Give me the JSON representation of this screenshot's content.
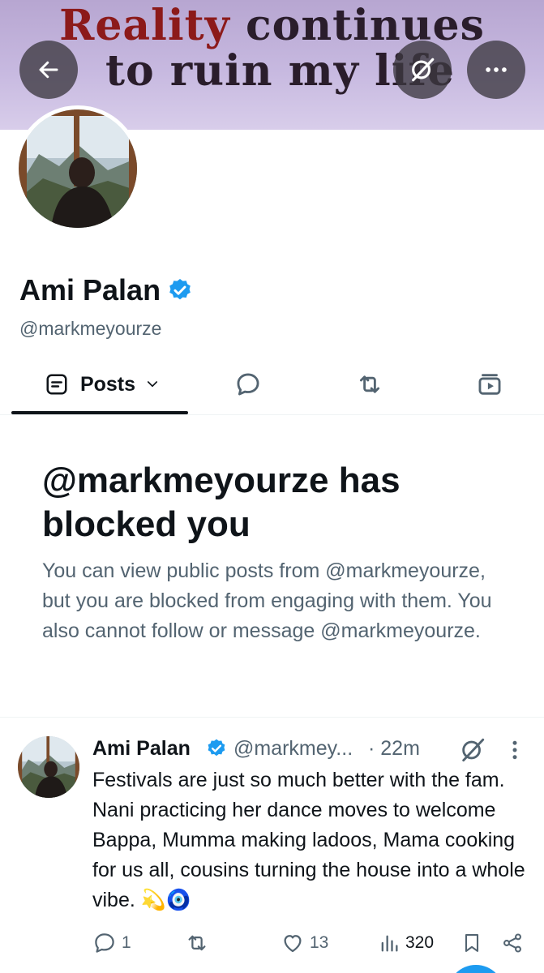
{
  "banner": {
    "line1_word1": "Reality",
    "line1_rest": "continues",
    "line2": "to ruin my life"
  },
  "header_buttons": {
    "back": "arrow-left-icon",
    "grok": "grok-icon",
    "more": "more-horizontal-icon"
  },
  "profile": {
    "display_name": "Ami Palan",
    "handle": "@markmeyourze",
    "verified": true
  },
  "tabs": [
    {
      "label": "Posts",
      "icon": "posts-icon",
      "selected": true
    },
    {
      "label": "",
      "icon": "reply-icon"
    },
    {
      "label": "",
      "icon": "repost-icon"
    },
    {
      "label": "",
      "icon": "media-icon"
    }
  ],
  "blocked": {
    "title": "@markmeyourze has blocked you",
    "body": "You can view public posts from @markmeyourze, but you are blocked from engaging with them. You also cannot follow or message @markmeyourze."
  },
  "post": {
    "name": "Ami Palan",
    "handle": "@markmey...",
    "time": "· 22m",
    "text": "Festivals are just so much better with the fam. Nani practicing her dance moves to welcome Bappa, Mumma making ladoos, Mama cooking for us all, cousins turning the house into a whole vibe. 💫🧿",
    "actions": {
      "replies": "1",
      "reposts": "",
      "likes": "13",
      "views": "320"
    }
  },
  "colors": {
    "accent": "#1d9bf0",
    "text": "#0f1419",
    "secondary": "#536471",
    "banner": "#c7b9e0"
  }
}
